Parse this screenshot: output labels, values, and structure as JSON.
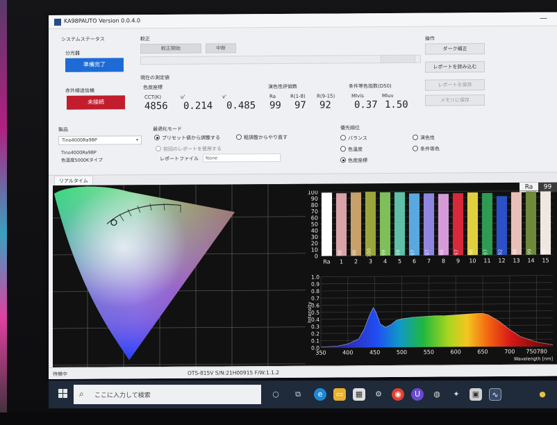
{
  "window": {
    "title": "KA98PAUTO Version 0.0.4.0"
  },
  "system_status": {
    "heading": "システムステータス",
    "spectrometer_label": "分光器",
    "spectrometer_status": "準備完了",
    "ir_label": "赤外線送信機",
    "ir_status": "未接続"
  },
  "calibration": {
    "heading": "較正",
    "start_button": "較正開始",
    "stop_button": "中断"
  },
  "current_measurement": {
    "heading": "現在の測定値",
    "chromaticity_heading": "色度座標",
    "cct_label": "CCT(K)",
    "cct_value": "4856",
    "u_label": "u'",
    "u_value": "0.214",
    "v_label": "v'",
    "v_value": "0.485",
    "cri_heading": "演色性評価数",
    "ra_label": "Ra",
    "ra_value": "99",
    "r1_8_label": "R(1-8)",
    "r1_8_value": "97",
    "r9_15_label": "R(9-15)",
    "r9_15_value": "92",
    "metamer_heading": "条件等色指数(D50)",
    "mivis_label": "MIvis",
    "mivis_value": "0.37",
    "miuv_label": "MIuv",
    "miuv_value": "1.50"
  },
  "operations": {
    "heading": "操作",
    "dark_correction": "ダーク補正",
    "load_report": "レポートを読み込む",
    "save_report": "レポートを保存",
    "save_memory": "メモリに保存"
  },
  "product": {
    "heading": "製品",
    "selected": "Tino4000Ra98P",
    "desc_line1": "Tino4000Ra98P",
    "desc_line2": "色温度5000Kタイプ"
  },
  "optimization_mode": {
    "heading": "最適化モード",
    "preset_option": "プリセット値から調整する",
    "redo_option": "粗調整からやり直す",
    "use_previous_report": "前回のレポートを使用する",
    "report_file_label": "レポートファイル",
    "report_file_value": "None"
  },
  "priority": {
    "heading": "優先順位",
    "options": [
      "バランス",
      "色温度",
      "色度座標",
      "演色性",
      "条件等色"
    ],
    "selected": "色度座標"
  },
  "tab": {
    "label": "リアルタイム"
  },
  "ra_badge": {
    "label": "Ra",
    "value": "99"
  },
  "statusbar": {
    "left": "待機中",
    "device": "OTS-815V  S/N:21H00915  F/W:1.1.2"
  },
  "taskbar": {
    "search_placeholder": "ここに入力して検索"
  },
  "colors": {
    "status_ready": "#1e6bd6",
    "status_error": "#c21d2c",
    "plot_background": "#111111"
  },
  "chart_data": [
    {
      "type": "bar",
      "categories": [
        "Ra",
        "1",
        "2",
        "3",
        "4",
        "5",
        "6",
        "7",
        "8",
        "9",
        "10",
        "11",
        "12",
        "13",
        "14",
        "15"
      ],
      "values": [
        99,
        98,
        99,
        100,
        99,
        99,
        97,
        97,
        96,
        97,
        98,
        97,
        92,
        98,
        99,
        99
      ],
      "colors": [
        "#ffffff",
        "#d9a3a8",
        "#c8a06a",
        "#9aa63c",
        "#7fbf5a",
        "#5ec0a6",
        "#5aa8e0",
        "#8f86e0",
        "#d59ad8",
        "#d8293a",
        "#e0d040",
        "#2e9a52",
        "#2b50c8",
        "#e8c0b8",
        "#6f8a3a",
        "#efe8e0"
      ],
      "title": "",
      "ylim": [
        0,
        100
      ],
      "yticks": [
        0,
        10,
        20,
        30,
        40,
        50,
        60,
        70,
        80,
        90,
        100
      ],
      "grid": true
    },
    {
      "type": "area",
      "x": [
        350,
        380,
        400,
        420,
        430,
        440,
        447,
        452,
        460,
        470,
        480,
        490,
        500,
        520,
        540,
        560,
        580,
        600,
        620,
        640,
        650,
        660,
        680,
        700,
        720,
        750,
        780
      ],
      "values": [
        0.01,
        0.02,
        0.05,
        0.12,
        0.25,
        0.45,
        0.56,
        0.5,
        0.33,
        0.28,
        0.32,
        0.38,
        0.4,
        0.42,
        0.43,
        0.44,
        0.44,
        0.45,
        0.46,
        0.47,
        0.47,
        0.45,
        0.36,
        0.24,
        0.14,
        0.06,
        0.02
      ],
      "title": "",
      "xlabel": "Wavelength [nm]",
      "ylabel": "Intensity",
      "xlim": [
        350,
        780
      ],
      "ylim": [
        0,
        1.0
      ],
      "xticks": [
        350,
        400,
        450,
        500,
        550,
        600,
        650,
        700,
        750
      ],
      "xtick_last_label": "750780",
      "yticks": [
        0,
        0.1,
        0.2,
        0.3,
        0.4,
        0.5,
        0.6,
        0.7,
        0.8,
        0.9,
        1.0
      ],
      "grid": true
    }
  ]
}
